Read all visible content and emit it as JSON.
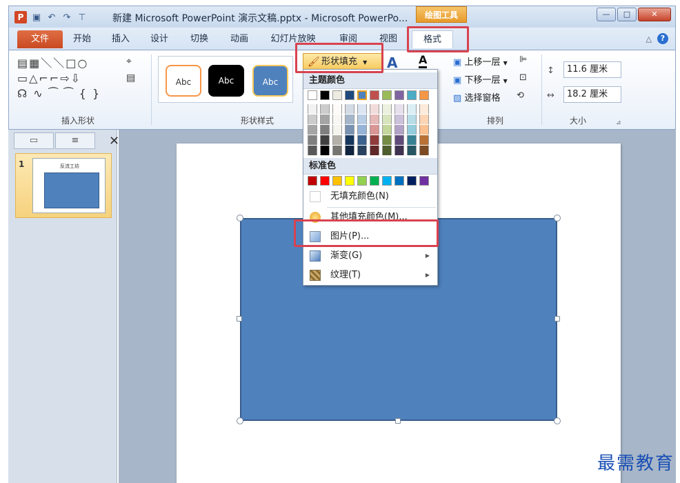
{
  "window": {
    "app_icon": "P",
    "title": "新建 Microsoft PowerPoint 演示文稿.pptx - Microsoft PowerPo...",
    "tool_tab_header": "绘图工具",
    "minimize": "—",
    "maximize": "□",
    "close": "✕"
  },
  "qat": {
    "save_icon": "▣",
    "undo_icon": "↶",
    "redo_icon": "↷",
    "customize_icon": "⊤"
  },
  "tabs": [
    {
      "label": "文件"
    },
    {
      "label": "开始"
    },
    {
      "label": "插入"
    },
    {
      "label": "设计"
    },
    {
      "label": "切换"
    },
    {
      "label": "动画"
    },
    {
      "label": "幻灯片放映"
    },
    {
      "label": "审阅"
    },
    {
      "label": "视图"
    },
    {
      "label": "格式"
    }
  ],
  "ribbon": {
    "groups": {
      "insert_shapes": "插入形状",
      "shape_styles": "形状样式",
      "arrange": "排列",
      "size": "大小"
    },
    "shape_glyphs_row1": "▤▦＼＼□○",
    "shape_glyphs_row2": "▭△⌐⌐⇨⇩",
    "shape_glyphs_row3": "☊ ∿ ⁀ ⁀ { }",
    "styles": [
      "Abc",
      "Abc",
      "Abc"
    ],
    "fill_button": "形状填充",
    "arrange": {
      "bring_forward": "上移一层",
      "send_backward": "下移一层",
      "selection_pane": "选择窗格"
    },
    "size": {
      "height": "11.6 厘米",
      "width": "18.2 厘米"
    }
  },
  "dropdown": {
    "theme_colors_header": "主题颜色",
    "standard_colors_header": "标准色",
    "theme_top_row": [
      "#ffffff",
      "#000000",
      "#eeece1",
      "#1f497d",
      "#4f81bd",
      "#c0504d",
      "#9bbb59",
      "#8064a2",
      "#4bacc6",
      "#f79646"
    ],
    "standard_colors": [
      "#c00000",
      "#ff0000",
      "#ffc000",
      "#ffff00",
      "#92d050",
      "#00b050",
      "#00b0f0",
      "#0070c0",
      "#002060",
      "#7030a0"
    ],
    "items": {
      "no_fill": "无填充颜色(N)",
      "more_colors": "其他填充颜色(M)...",
      "picture": "图片(P)...",
      "gradient": "渐变(G)",
      "texture": "纹理(T)"
    }
  },
  "slide_thumb": {
    "number": "1",
    "title": "反流工坊"
  },
  "watermark": "最需教育"
}
